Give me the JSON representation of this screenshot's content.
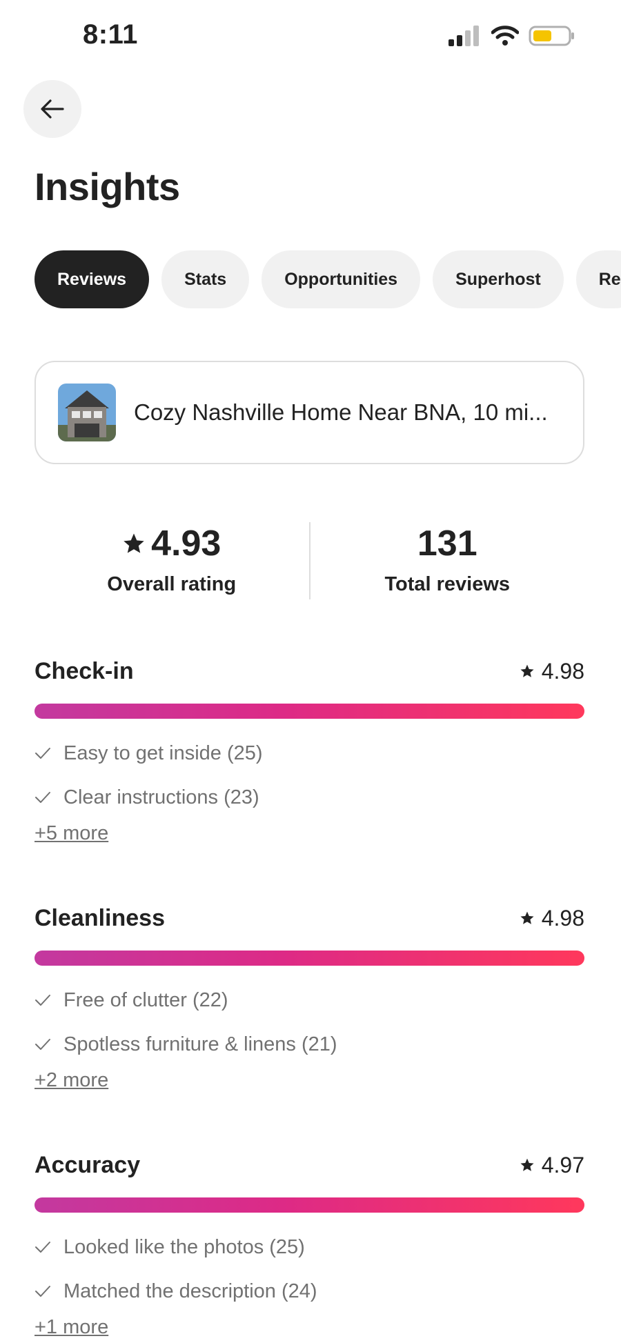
{
  "status_bar": {
    "time": "8:11"
  },
  "header": {
    "title": "Insights"
  },
  "tabs": [
    {
      "label": "Reviews",
      "active": true
    },
    {
      "label": "Stats",
      "active": false
    },
    {
      "label": "Opportunities",
      "active": false
    },
    {
      "label": "Superhost",
      "active": false
    },
    {
      "label": "Re",
      "active": false
    }
  ],
  "listing": {
    "title": "Cozy Nashville Home Near BNA, 10 mi..."
  },
  "summary": {
    "overall_rating": "4.93",
    "overall_label": "Overall rating",
    "total_reviews": "131",
    "total_label": "Total reviews"
  },
  "categories": [
    {
      "name": "Check-in",
      "score": "4.98",
      "tags": [
        "Easy to get inside (25)",
        "Clear instructions (23)"
      ],
      "more": "+5 more"
    },
    {
      "name": "Cleanliness",
      "score": "4.98",
      "tags": [
        "Free of clutter (22)",
        "Spotless furniture & linens (21)"
      ],
      "more": "+2 more"
    },
    {
      "name": "Accuracy",
      "score": "4.97",
      "tags": [
        "Looked like the photos (25)",
        "Matched the description (24)"
      ],
      "more": "+1 more"
    }
  ],
  "colors": {
    "accent_start": "#c3399f",
    "accent_end": "#ff385c",
    "battery": "#f5c400"
  }
}
